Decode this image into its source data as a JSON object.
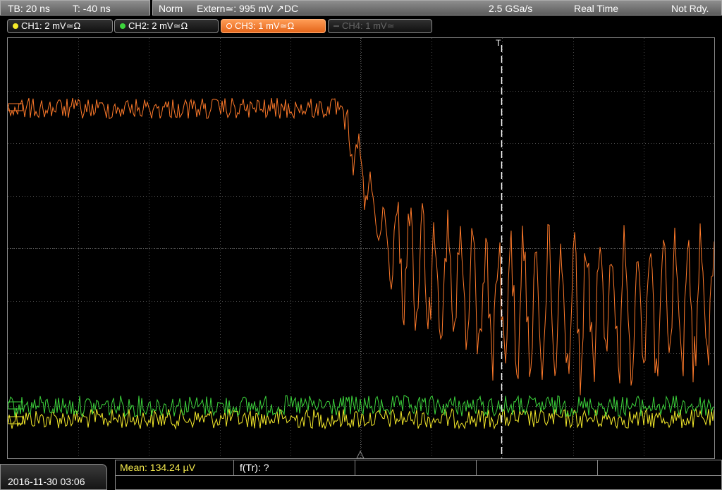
{
  "status": {
    "timebase": "TB: 20 ns",
    "trigger_time": "T: -40 ns",
    "mode": "Norm",
    "trigger_source": "Extern≃: 995 mV ↗DC",
    "sample_rate": "2.5 GSa/s",
    "acquisition": "Real Time",
    "state": "Not Rdy."
  },
  "channels": [
    {
      "label": "CH1: 2 mV≃Ω",
      "color": "#f5ea2a",
      "active": false,
      "enabled": true
    },
    {
      "label": "CH2: 2 mV≃Ω",
      "color": "#3cd43c",
      "active": false,
      "enabled": true
    },
    {
      "label": "CH3: 1 mV≃Ω",
      "color": "#ff7a2a",
      "active": true,
      "enabled": true
    },
    {
      "label": "CH4: 1 mV≃",
      "color": "#666666",
      "active": false,
      "enabled": false
    }
  ],
  "trigger_marker": "T",
  "footer": {
    "datetime": "2016-11-30 03:06",
    "mean": "Mean: 134.24 µV",
    "ftr": "f(Tr): ?"
  },
  "colors": {
    "ch1": "#f5ea2a",
    "ch2": "#3cd43c",
    "ch3": "#ff7a2a",
    "grid": "#4a4a4a"
  }
}
